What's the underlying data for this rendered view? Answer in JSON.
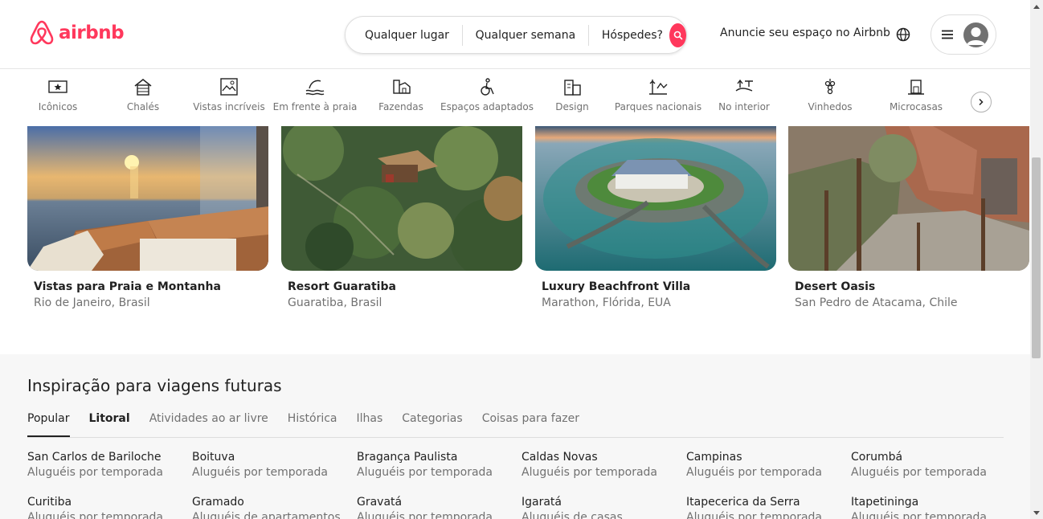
{
  "header": {
    "logo_text": "airbnb",
    "search": {
      "where": "Qualquer lugar",
      "when": "Qualquer semana",
      "who": "Hóspedes?"
    },
    "host_link": "Anuncie seu espaço no Airbnb"
  },
  "categories": [
    {
      "label": "Icônicos",
      "icon": "trophy-icon"
    },
    {
      "label": "Chalés",
      "icon": "chalet-icon"
    },
    {
      "label": "Vistas incríveis",
      "icon": "view-icon"
    },
    {
      "label": "Em frente à praia",
      "icon": "beach-icon"
    },
    {
      "label": "Fazendas",
      "icon": "farm-icon"
    },
    {
      "label": "Espaços adaptados",
      "icon": "accessible-icon"
    },
    {
      "label": "Design",
      "icon": "design-icon"
    },
    {
      "label": "Parques nacionais",
      "icon": "park-icon"
    },
    {
      "label": "No interior",
      "icon": "countryside-icon"
    },
    {
      "label": "Vinhedos",
      "icon": "grapes-icon"
    },
    {
      "label": "Microcasas",
      "icon": "tiny-home-icon"
    }
  ],
  "listings": [
    {
      "title": "Vistas para Praia e Montanha",
      "location": "Rio de Janeiro, Brasil"
    },
    {
      "title": "Resort Guaratiba",
      "location": "Guaratiba, Brasil"
    },
    {
      "title": "Luxury Beachfront Villa",
      "location": "Marathon, Flórida, EUA"
    },
    {
      "title": "Desert Oasis",
      "location": "San Pedro de Atacama, Chile"
    }
  ],
  "inspiration": {
    "title": "Inspiração para viagens futuras",
    "tabs": [
      "Popular",
      "Litoral",
      "Atividades ao ar livre",
      "Histórica",
      "Ilhas",
      "Categorias",
      "Coisas para fazer"
    ],
    "destinations": [
      {
        "name": "San Carlos de Bariloche",
        "type": "Aluguéis por temporada"
      },
      {
        "name": "Boituva",
        "type": "Aluguéis por temporada"
      },
      {
        "name": "Bragança Paulista",
        "type": "Aluguéis por temporada"
      },
      {
        "name": "Caldas Novas",
        "type": "Aluguéis por temporada"
      },
      {
        "name": "Campinas",
        "type": "Aluguéis por temporada"
      },
      {
        "name": "Corumbá",
        "type": "Aluguéis por temporada"
      },
      {
        "name": "Curitiba",
        "type": "Aluguéis por temporada"
      },
      {
        "name": "Gramado",
        "type": "Aluguéis de apartamentos"
      },
      {
        "name": "Gravatá",
        "type": "Aluguéis por temporada"
      },
      {
        "name": "Igaratá",
        "type": "Aluguéis de casas"
      },
      {
        "name": "Itapecerica da Serra",
        "type": "Aluguéis por temporada"
      },
      {
        "name": "Itapetininga",
        "type": "Aluguéis por temporada"
      }
    ]
  },
  "colors": {
    "brand": "#ff385c",
    "text": "#222222",
    "muted": "#717171"
  }
}
